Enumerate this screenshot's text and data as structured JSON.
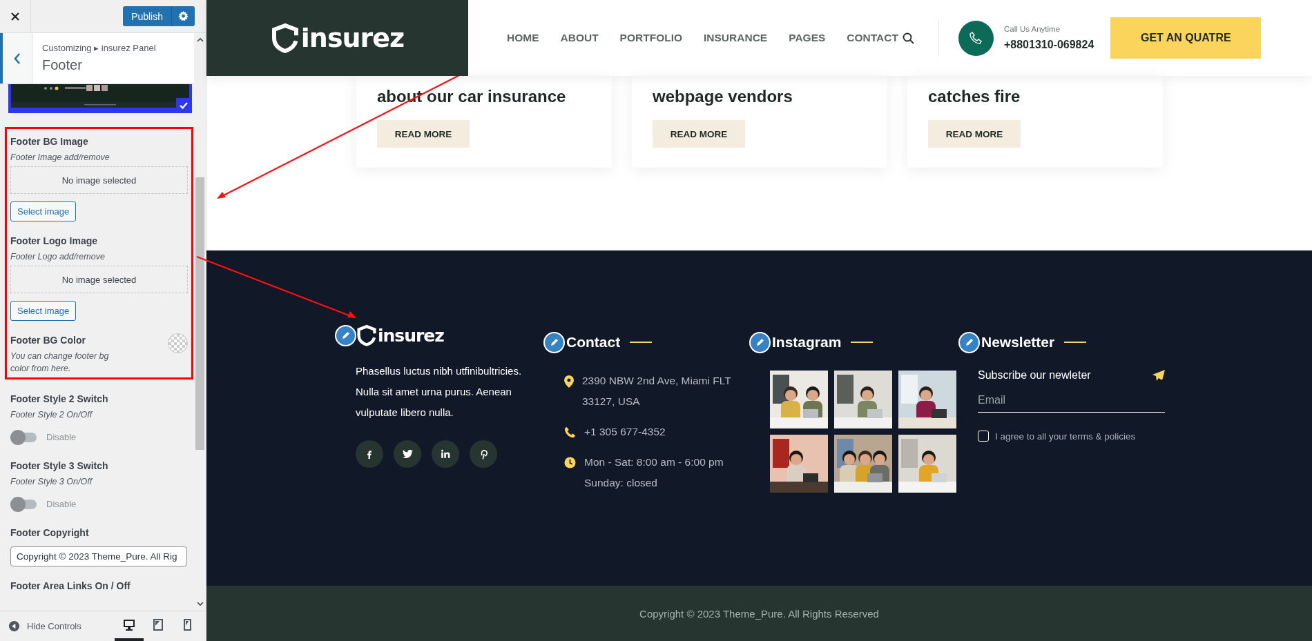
{
  "customizer": {
    "publish_button": "Publish",
    "breadcrumb": "Customizing ▸ insurez Panel",
    "section_title": "Footer",
    "controls": [
      {
        "label": "Footer BG Image",
        "description": "Footer Image add/remove",
        "empty_text": "No image selected",
        "button": "Select image",
        "highlighted": true
      },
      {
        "label": "Footer Logo Image",
        "description": "Footer Logo add/remove",
        "empty_text": "No image selected",
        "button": "Select image",
        "highlighted": true
      },
      {
        "kind": "color",
        "label": "Footer BG Color",
        "description": "You can change footer bg color from here.",
        "highlighted": true
      },
      {
        "kind": "toggle",
        "label": "Footer Style 2 Switch",
        "description": "Footer Style 2 On/Off",
        "on": false,
        "state_text": "Disable",
        "highlighted": false
      },
      {
        "kind": "toggle",
        "label": "Footer Style 3 Switch",
        "description": "Footer Style 3 On/Off",
        "on": false,
        "state_text": "Disable",
        "highlighted": false
      },
      {
        "kind": "text",
        "label": "Footer Copyright",
        "value": "Copyright © 2023 Theme_Pure. All Rig",
        "highlighted": false
      },
      {
        "kind": "heading",
        "label": "Footer Area Links On / Off",
        "highlighted": false
      }
    ],
    "hide_controls": "Hide Controls",
    "devices": [
      {
        "kind": "desktop",
        "selected": true
      },
      {
        "kind": "tablet",
        "selected": false
      },
      {
        "kind": "mobile",
        "selected": false
      }
    ]
  },
  "site": {
    "logo": "insurez",
    "nav": [
      "HOME",
      "ABOUT",
      "PORTFOLIO",
      "INSURANCE",
      "PAGES",
      "CONTACT"
    ],
    "call_label": "Call Us Anytime",
    "phone": "+8801310-069824",
    "cta": "GET AN QUATRE",
    "cards": [
      {
        "title": "about our car insurance",
        "button": "READ MORE"
      },
      {
        "title": "webpage vendors",
        "button": "READ MORE"
      },
      {
        "title": "catches fire",
        "button": "READ MORE"
      }
    ],
    "footer": {
      "logo": "insurez",
      "about": "Phasellus luctus nibh utfinibultricies. Nulla sit amet urna purus. Aenean vulputate libero nulla.",
      "socials": [
        {
          "kind": "facebook"
        },
        {
          "kind": "twitter"
        },
        {
          "kind": "linkedin"
        },
        {
          "kind": "pinterest"
        }
      ],
      "contact_title": "Contact",
      "contact": [
        {
          "kind": "address",
          "lines": [
            "2390 NBW 2nd Ave, Miami FLT",
            "33127, USA"
          ]
        },
        {
          "kind": "phone",
          "lines": [
            "+1 305 677-4352"
          ]
        },
        {
          "kind": "hours",
          "lines": [
            "Mon - Sat: 8:00 am - 6:00 pm",
            "Sunday: closed"
          ]
        }
      ],
      "instagram_title": "Instagram",
      "newsletter_title": "Newsletter",
      "newsletter_text": "Subscribe our newleter",
      "email_placeholder": "Email",
      "agree_text": "I agree to all your terms & policies",
      "agree_checked": false
    },
    "copyright": "Copyright © 2023 Theme_Pure. All Rights Reserved"
  }
}
